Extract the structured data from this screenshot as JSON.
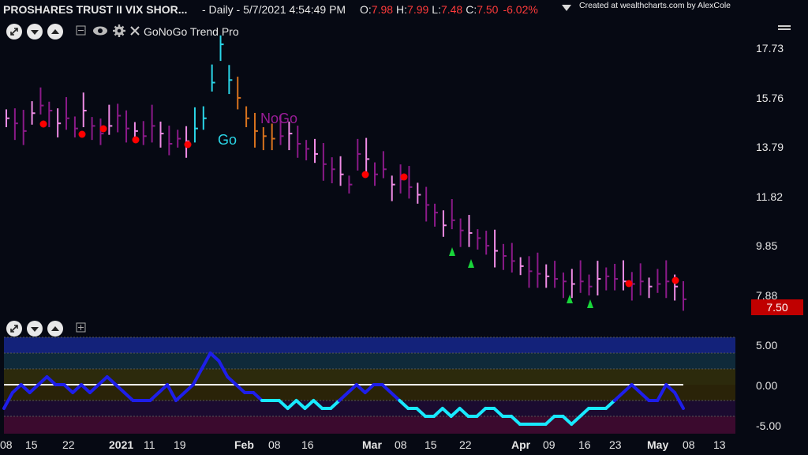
{
  "header": {
    "symbol": "PROSHARES TRUST II VIX SHOR...",
    "interval_time": "- Daily - 5/7/2021 4:54:49 PM",
    "open_label": "O:",
    "open": "7.98",
    "high_label": "H:",
    "high": "7.99",
    "low_label": "L:",
    "low": "7.48",
    "close_label": "C:",
    "close": "7.50",
    "change": "-6.02%",
    "credit": "Created at wealthcharts.com by AlexCole"
  },
  "indicator": {
    "name": "GoNoGo Trend Pro"
  },
  "annotations": {
    "go": "Go",
    "nogo": "NoGo"
  },
  "price_axis": [
    "17.73",
    "15.76",
    "13.79",
    "11.82",
    "9.85",
    "7.88"
  ],
  "price_tag": "7.50",
  "osc_axis": [
    "5.00",
    "0.00",
    "-5.00"
  ],
  "x_axis": [
    {
      "label": "08",
      "bold": false
    },
    {
      "label": "15",
      "bold": false
    },
    {
      "label": "22",
      "bold": false
    },
    {
      "label": "2021",
      "bold": true
    },
    {
      "label": "11",
      "bold": false
    },
    {
      "label": "19",
      "bold": false
    },
    {
      "label": "Feb",
      "bold": true
    },
    {
      "label": "08",
      "bold": false
    },
    {
      "label": "16",
      "bold": false
    },
    {
      "label": "Mar",
      "bold": true
    },
    {
      "label": "08",
      "bold": false
    },
    {
      "label": "15",
      "bold": false
    },
    {
      "label": "22",
      "bold": false
    },
    {
      "label": "Apr",
      "bold": true
    },
    {
      "label": "09",
      "bold": false
    },
    {
      "label": "16",
      "bold": false
    },
    {
      "label": "23",
      "bold": false
    },
    {
      "label": "May",
      "bold": true
    },
    {
      "label": "08",
      "bold": false
    },
    {
      "label": "13",
      "bold": false
    }
  ],
  "colors": {
    "go": "#2ad6e8",
    "nogo": "#8b1a89",
    "nogo_light": "#f08ce6",
    "amber": "#d9731e",
    "down": "#ff0000",
    "up": "#19d63a",
    "osc_line": "#1e1eea",
    "osc_cyan": "#18e9ff"
  },
  "chart_data": {
    "type": "line",
    "title": "",
    "price_series": [
      14.6,
      14.4,
      14.1,
      14.8,
      15.1,
      14.9,
      14.4,
      14.6,
      14.2,
      14.9,
      14.3,
      14.0,
      14.3,
      14.7,
      14.2,
      14.1,
      13.9,
      14.3,
      14.0,
      13.6,
      13.8,
      13.7,
      14.2,
      14.6,
      16.0,
      17.5,
      16.1,
      15.4,
      14.6,
      14.1,
      13.9,
      13.8,
      13.9,
      14.0,
      13.6,
      13.4,
      13.2,
      12.8,
      12.6,
      12.4,
      12.0,
      13.2,
      13.0,
      12.4,
      12.6,
      12.0,
      12.2,
      11.9,
      11.6,
      11.2,
      10.9,
      10.4,
      10.6,
      10.2,
      10.1,
      9.9,
      9.6,
      9.4,
      9.2,
      9.0,
      8.8,
      8.6,
      8.5,
      8.4,
      8.3,
      8.2,
      8.1,
      8.2,
      8.0,
      8.3,
      8.4,
      8.3,
      8.2,
      8.1,
      8.2,
      8.0,
      8.1,
      8.2,
      8.0,
      7.5
    ],
    "oscillator_series": [
      -3,
      -1,
      0,
      -1,
      0,
      1,
      0,
      0,
      -1,
      0,
      -1,
      0,
      1,
      0,
      -1,
      -2,
      -2,
      -2,
      -1,
      0,
      -2,
      -1,
      0,
      2,
      4,
      3,
      1,
      0,
      -1,
      -1,
      -2,
      -2,
      -2,
      -3,
      -2,
      -3,
      -2,
      -3,
      -3,
      -2,
      -1,
      0,
      -1,
      0,
      0,
      -1,
      -2,
      -3,
      -3,
      -4,
      -4,
      -3,
      -4,
      -3,
      -4,
      -4,
      -3,
      -3,
      -4,
      -4,
      -5,
      -5,
      -5,
      -5,
      -4,
      -4,
      -5,
      -4,
      -3,
      -3,
      -3,
      -2,
      -1,
      0,
      -1,
      -2,
      -2,
      0,
      -1,
      -3
    ],
    "ylim": [
      7.0,
      18.0
    ],
    "osc_ylim": [
      -6,
      6
    ]
  }
}
